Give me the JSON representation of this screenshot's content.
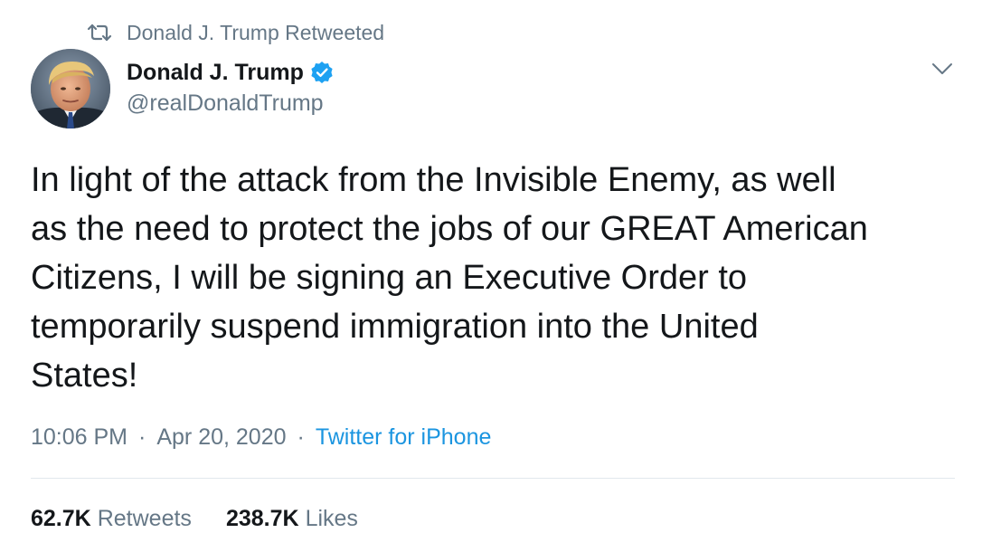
{
  "retweet_banner": {
    "icon": "retweet-icon",
    "text": "Donald J. Trump Retweeted"
  },
  "author": {
    "display_name": "Donald J. Trump",
    "verified": true,
    "verified_icon": "verified-badge-icon",
    "handle": "@realDonaldTrump",
    "avatar_icon": "profile-avatar"
  },
  "menu": {
    "icon": "chevron-down-icon"
  },
  "tweet": {
    "text": "In light of the attack from the Invisible Enemy, as well as the need to protect the jobs of our GREAT American Citizens, I will be signing an Executive Order to temporarily suspend immigration into the United States!",
    "lines": [
      "In light of the attack from the Invisible Enemy, as well",
      "as the need to protect the jobs of our GREAT American",
      "Citizens, I will be signing an Executive Order to",
      "temporarily suspend immigration into the United",
      "States!"
    ],
    "time": "10:06 PM",
    "date": "Apr 20, 2020",
    "separator": "·",
    "source": "Twitter for iPhone"
  },
  "stats": {
    "retweets_count": "62.7K",
    "retweets_label": "Retweets",
    "likes_count": "238.7K",
    "likes_label": "Likes"
  },
  "colors": {
    "text_primary": "#14171a",
    "text_secondary": "#657786",
    "link": "#1b95e0",
    "verified": "#1da1f2",
    "divider": "#e1e8ed"
  }
}
